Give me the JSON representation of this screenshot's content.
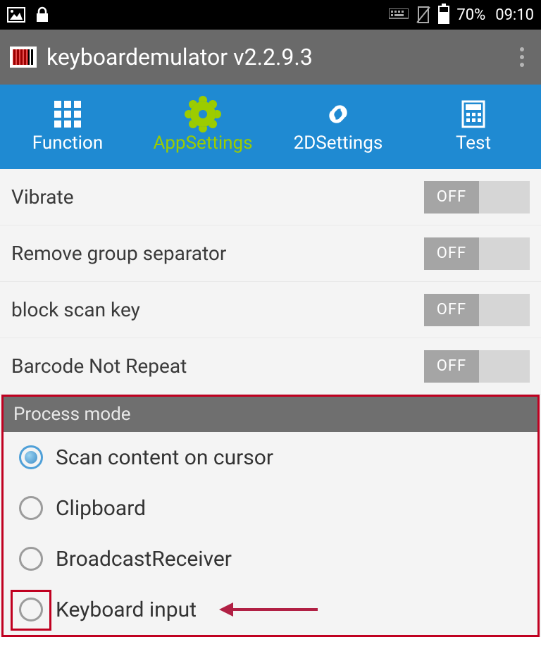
{
  "statusbar": {
    "battery_pct": "70%",
    "time": "09:10"
  },
  "appbar": {
    "title": "keyboardemulator v2.2.9.3"
  },
  "tabs": [
    {
      "label": "Function"
    },
    {
      "label": "AppSettings"
    },
    {
      "label": "2DSettings"
    },
    {
      "label": "Test"
    }
  ],
  "toggles": [
    {
      "label": "Vibrate",
      "state": "OFF"
    },
    {
      "label": "Remove group separator",
      "state": "OFF"
    },
    {
      "label": "block scan key",
      "state": "OFF"
    },
    {
      "label": "Barcode Not Repeat",
      "state": "OFF"
    }
  ],
  "section": {
    "title": "Process mode"
  },
  "radios": [
    {
      "label": "Scan content on cursor",
      "selected": true
    },
    {
      "label": "Clipboard",
      "selected": false
    },
    {
      "label": "BroadcastReceiver",
      "selected": false
    },
    {
      "label": "Keyboard input",
      "selected": false
    }
  ]
}
